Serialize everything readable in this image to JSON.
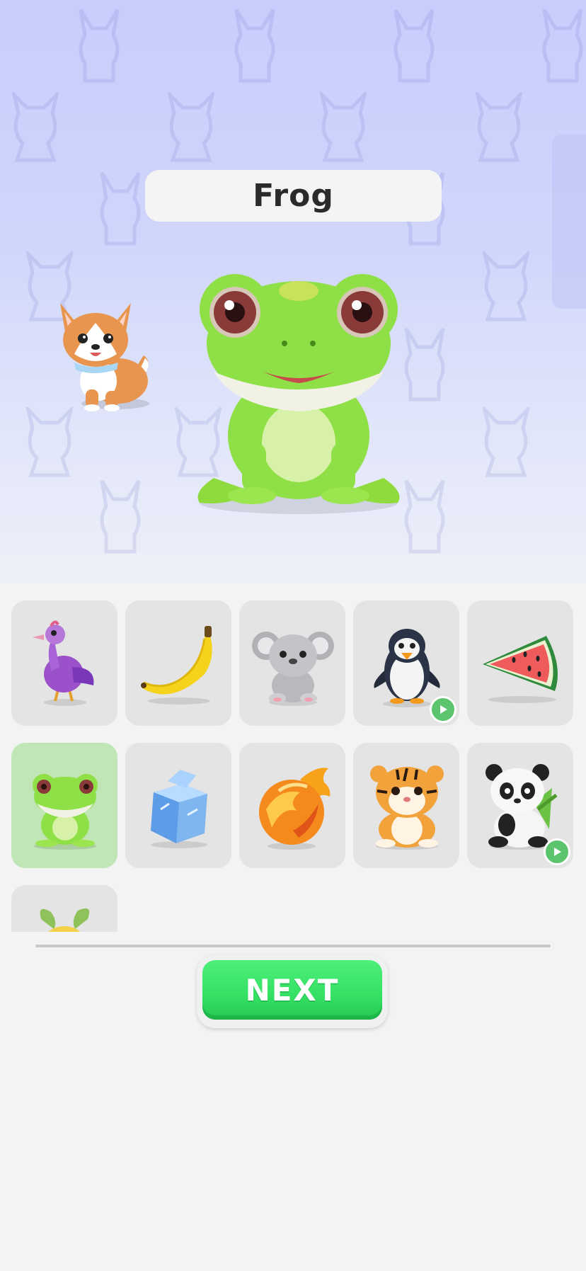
{
  "selected_character": {
    "name": "Frog",
    "icon": "frog-icon"
  },
  "companion": {
    "icon": "corgi-dog-icon"
  },
  "grid": {
    "items": [
      {
        "icon": "purple-bird-icon",
        "selected": false,
        "video_badge": false
      },
      {
        "icon": "banana-icon",
        "selected": false,
        "video_badge": false
      },
      {
        "icon": "koala-icon",
        "selected": false,
        "video_badge": false
      },
      {
        "icon": "penguin-icon",
        "selected": false,
        "video_badge": true
      },
      {
        "icon": "watermelon-slice-icon",
        "selected": false,
        "video_badge": false
      },
      {
        "icon": "frog-icon",
        "selected": true,
        "video_badge": false
      },
      {
        "icon": "ice-cube-icon",
        "selected": false,
        "video_badge": false
      },
      {
        "icon": "fireball-icon",
        "selected": false,
        "video_badge": false
      },
      {
        "icon": "tiger-icon",
        "selected": false,
        "video_badge": false
      },
      {
        "icon": "panda-icon",
        "selected": false,
        "video_badge": true
      },
      {
        "icon": "green-leaf-creature-icon",
        "selected": false,
        "video_badge": false
      }
    ]
  },
  "actions": {
    "next_label": "NEXT"
  },
  "colors": {
    "accent_green": "#34e064",
    "selected_tile": "#bfe6b4",
    "tile": "#e4e4e4",
    "hero_top": "#c8cdfc"
  }
}
